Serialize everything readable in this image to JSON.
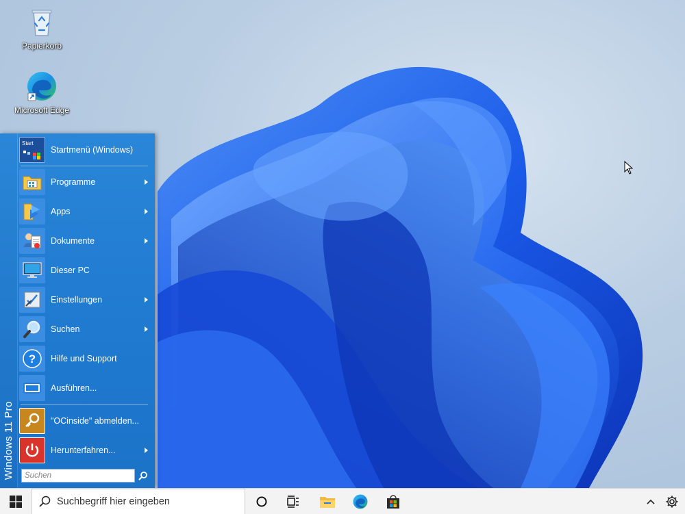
{
  "desktop": {
    "icons": [
      {
        "name": "recycle-bin",
        "label": "Papierkorb"
      },
      {
        "name": "microsoft-edge",
        "label": "Microsoft Edge"
      }
    ]
  },
  "start_menu": {
    "side_banner": "Windows 11 Pro",
    "header": {
      "label": "Startmenü (Windows)",
      "icon": "start-logo-icon",
      "icon_text": "Start"
    },
    "items": [
      {
        "label": "Programme",
        "icon": "programs-folder-icon",
        "submenu": true
      },
      {
        "label": "Apps",
        "icon": "apps-icon",
        "submenu": true
      },
      {
        "label": "Dokumente",
        "icon": "documents-icon",
        "submenu": true
      },
      {
        "label": "Dieser PC",
        "icon": "monitor-icon",
        "submenu": false
      },
      {
        "label": "Einstellungen",
        "icon": "settings-icon",
        "submenu": true
      },
      {
        "label": "Suchen",
        "icon": "search-magnifier-icon",
        "submenu": true
      },
      {
        "label": "Hilfe und Support",
        "icon": "help-icon",
        "submenu": false
      },
      {
        "label": "Ausführen...",
        "icon": "run-icon",
        "submenu": false
      }
    ],
    "footer_items": [
      {
        "label": "\"OCinside\" abmelden...",
        "icon": "logoff-key-icon",
        "submenu": false
      },
      {
        "label": "Herunterfahren...",
        "icon": "power-icon",
        "submenu": true
      }
    ],
    "search": {
      "placeholder": "Suchen"
    }
  },
  "taskbar": {
    "search_placeholder": "Suchbegriff hier eingeben",
    "pinned": [
      "cortana-icon",
      "task-view-icon",
      "file-explorer-icon",
      "edge-icon",
      "store-icon"
    ],
    "tray": [
      "show-hidden-icons-chevron",
      "settings-gear-icon"
    ]
  },
  "colors": {
    "menu_blue": "#1f7ad0",
    "taskbar": "#f3f3f3",
    "wallpaper_bloom": "#1a5ae8"
  }
}
